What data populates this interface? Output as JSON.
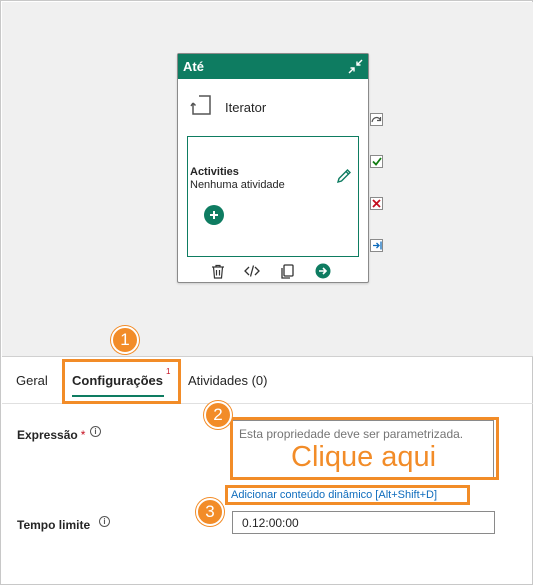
{
  "card": {
    "title": "Até",
    "iterator_label": "Iterator",
    "activities_title": "Activities",
    "activities_subtitle": "Nenhuma atividade"
  },
  "tabs": [
    {
      "label": "Geral"
    },
    {
      "label": "Configurações",
      "badge": "1"
    },
    {
      "label": "Atividades (0)"
    }
  ],
  "form": {
    "expression": {
      "label": "Expressão",
      "required_mark": "*",
      "placeholder": "Esta propriedade deve ser parametrizada."
    },
    "dynamic_link": "Adicionar conteúdo dinâmico [Alt+Shift+D]",
    "timeout": {
      "label": "Tempo limite",
      "value": "0.12:00:00"
    }
  },
  "annotations": {
    "step1": "1",
    "step2": "2",
    "step3": "3",
    "click_here": "Clique aqui",
    "highlight_color": "#f28c28"
  },
  "colors": {
    "accent": "#0e7c61",
    "link": "#0f6cbd",
    "required": "#c50f1f",
    "canvas": "#f0f0f0"
  },
  "icons": {
    "collapse": "collapse-icon",
    "iterator": "iterator-icon",
    "edit": "pencil-icon",
    "add": "plus-icon",
    "delete": "trash-icon",
    "code": "code-icon",
    "copy": "copy-icon",
    "go": "arrow-right-icon",
    "skip": "skip-arrow-icon",
    "success": "check-icon",
    "fail": "x-icon",
    "completion": "arrow-into-icon",
    "info": "info-icon"
  }
}
